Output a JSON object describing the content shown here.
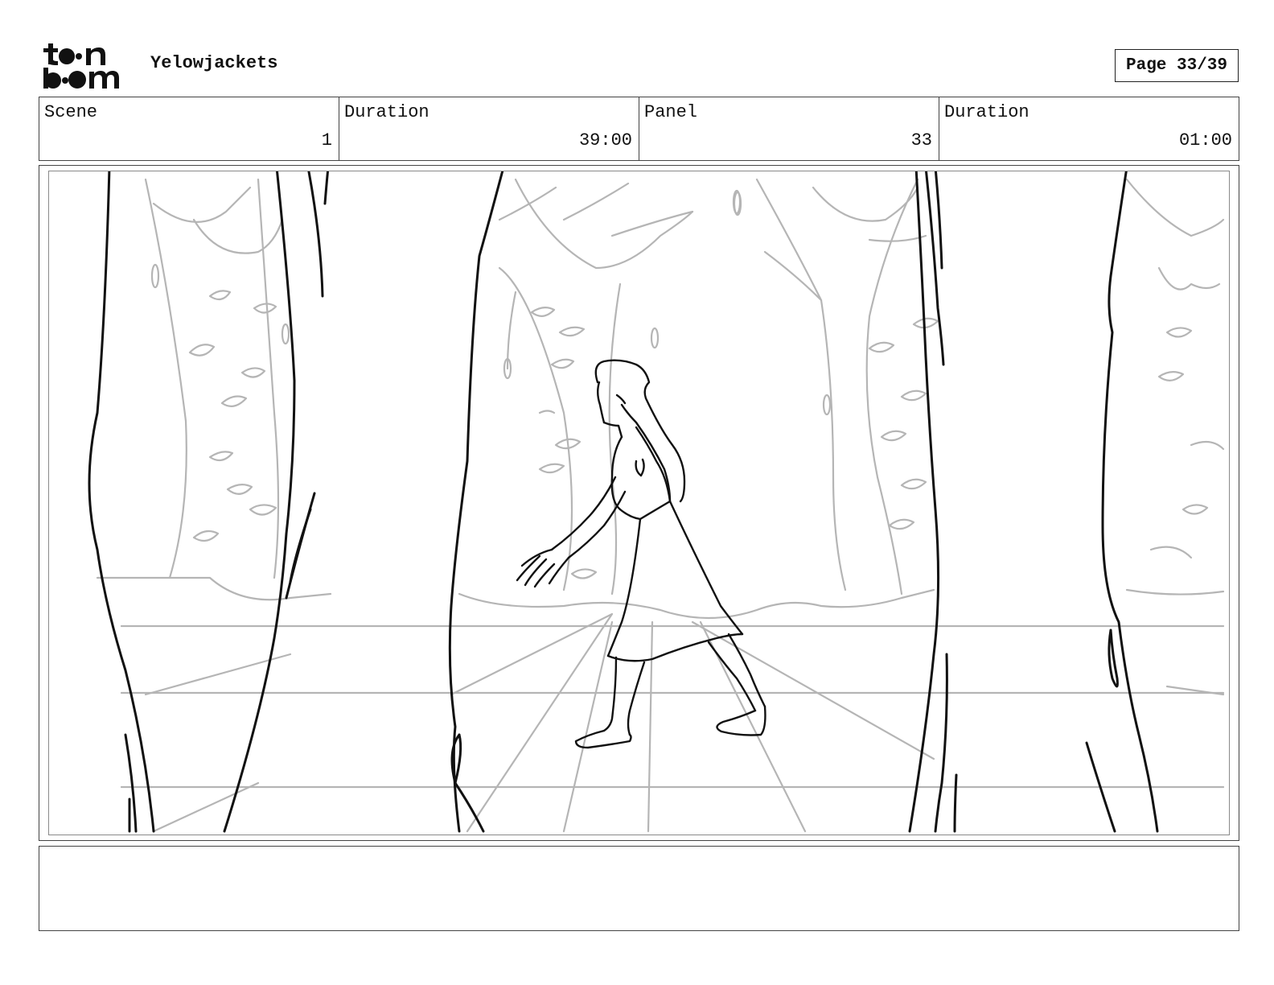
{
  "header": {
    "logo_text_top": "toon",
    "logo_text_bottom": "boom",
    "project_title": "Yelowjackets",
    "page_label": "Page 33/39"
  },
  "info": {
    "scene_label": "Scene",
    "scene_value": "1",
    "scene_duration_label": "Duration",
    "scene_duration_value": "39:00",
    "panel_label": "Panel",
    "panel_value": "33",
    "panel_duration_label": "Duration",
    "panel_duration_value": "01:00"
  },
  "caption": {
    "text": ""
  }
}
